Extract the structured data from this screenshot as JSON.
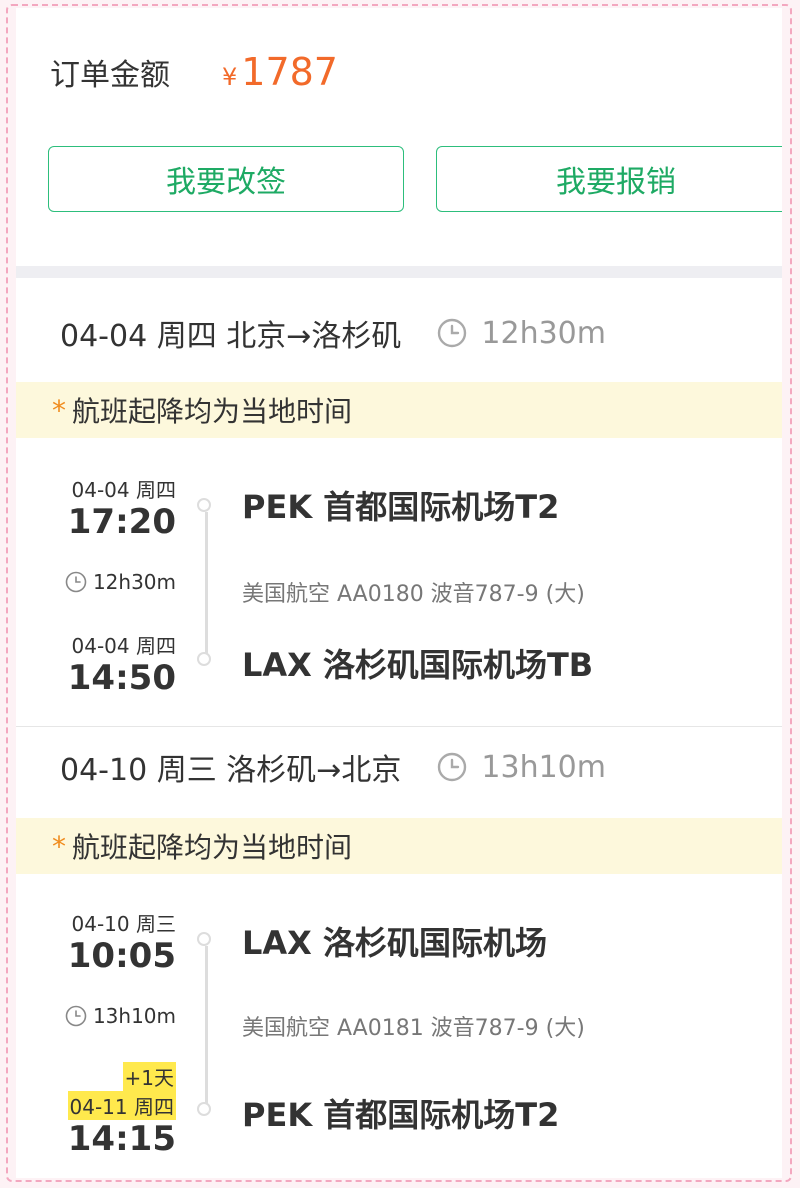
{
  "order": {
    "label": "订单金额",
    "currency": "¥",
    "amount": "1787"
  },
  "buttons": {
    "rebook": "我要改签",
    "reimburse": "我要报销"
  },
  "notice_text": "航班起降均为当地时间",
  "notice_star": "*",
  "segments": [
    {
      "header": "04-04 周四 北京→洛杉矶",
      "duration": "12h30m",
      "dep_date": "04-04 周四",
      "dep_time": "17:20",
      "dep_airport": "PEK 首都国际机场T2",
      "flight_duration": "12h30m",
      "flight_info": "美国航空 AA0180 波音787-9 (大)",
      "arr_date": "04-04 周四",
      "arr_time": "14:50",
      "arr_airport": "LAX 洛杉矶国际机场TB"
    },
    {
      "header": "04-10 周三 洛杉矶→北京",
      "duration": "13h10m",
      "dep_date": "04-10 周三",
      "dep_time": "10:05",
      "dep_airport": "LAX 洛杉矶国际机场",
      "flight_duration": "13h10m",
      "flight_info": "美国航空 AA0181 波音787-9 (大)",
      "arr_day_offset": "+1天",
      "arr_date": "04-11 周四",
      "arr_time": "14:15",
      "arr_airport": "PEK 首都国际机场T2"
    }
  ],
  "colors": {
    "accent_green": "#1eaa64",
    "price_orange": "#f26a2a",
    "notice_bg": "#fdf8dc",
    "highlight_yellow": "#ffe94d"
  }
}
